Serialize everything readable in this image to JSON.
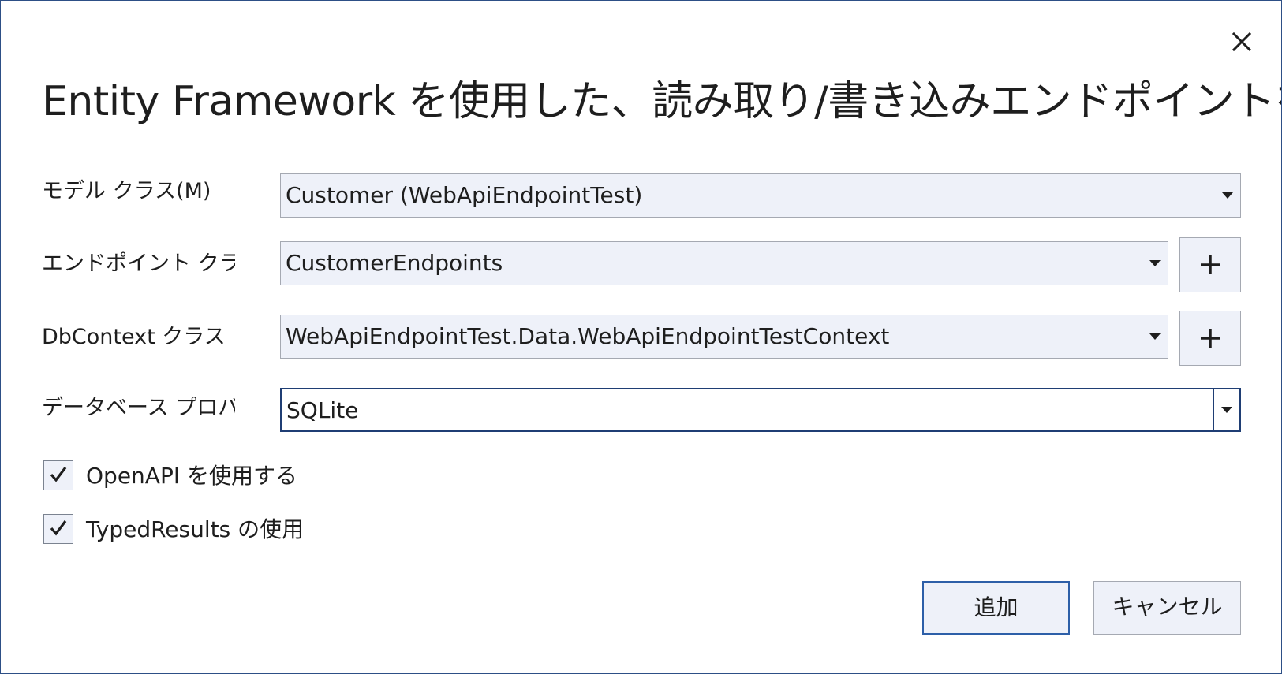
{
  "dialog": {
    "title": "Entity Framework を使用した、読み取り/書き込みエンドポイントを追加"
  },
  "fields": {
    "model_class": {
      "label": "モデル クラス(M)",
      "value": "Customer (WebApiEndpointTest)"
    },
    "endpoint_class": {
      "label": "エンドポイント クラス",
      "value": "CustomerEndpoints",
      "add_label": "+"
    },
    "dbcontext_class": {
      "label": "DbContext クラス",
      "value": "WebApiEndpointTest.Data.WebApiEndpointTestContext",
      "add_label": "+"
    },
    "database_provider": {
      "label": "データベース プロバイダー",
      "value": "SQLite"
    }
  },
  "options": {
    "use_openapi": {
      "label": "OpenAPI を使用する",
      "checked": true
    },
    "use_typed_results": {
      "label": "TypedResults の使用",
      "checked": true
    }
  },
  "buttons": {
    "add": "追加",
    "cancel": "キャンセル"
  },
  "colors": {
    "border_dialog": "#2d4f86",
    "focus_border": "#1f3e74",
    "control_bg": "#eef1f9",
    "control_border": "#a5a9b2",
    "primary_border": "#2d5fa8",
    "text": "#1e1e1e"
  },
  "icons": {
    "close": "close-icon",
    "dropdown": "chevron-down-icon",
    "add": "plus-icon",
    "check": "checkmark-icon"
  }
}
